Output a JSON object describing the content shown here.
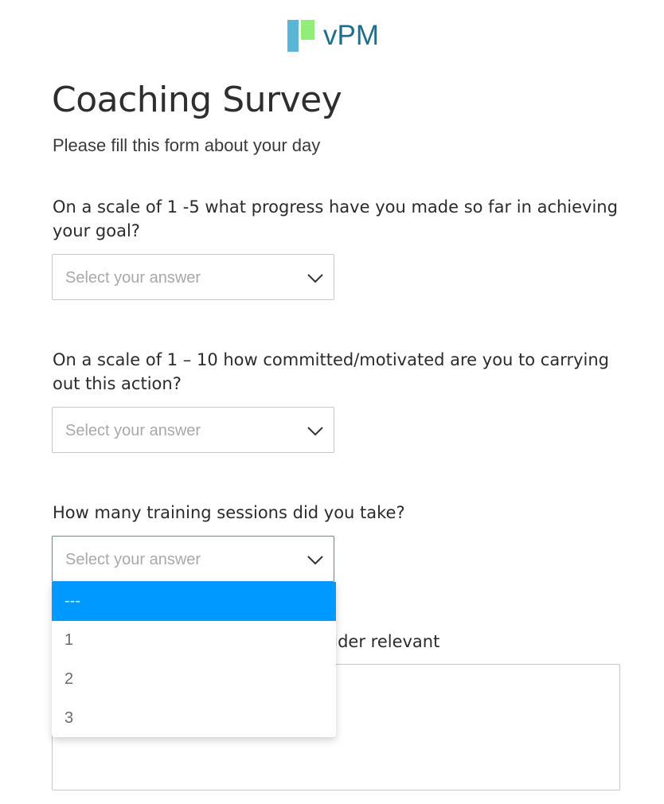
{
  "brand": {
    "logo_text": "vPM",
    "colors": {
      "logo_blue": "#5bb6d5",
      "logo_green": "#8fef7a",
      "logo_text": "#1f6f8b",
      "accent": "#0099ff"
    }
  },
  "form": {
    "title": "Coaching Survey",
    "subtitle": "Please fill this form about your day",
    "questions": [
      {
        "label": "On a scale of 1 -5 what progress have you made so far in achieving your goal?",
        "placeholder": "Select your answer",
        "state": "closed"
      },
      {
        "label": "On a scale of 1 – 10 how committed/motivated are you to carrying out this action?",
        "placeholder": "Select your answer",
        "state": "closed"
      },
      {
        "label": "How many training sessions did you take?",
        "placeholder": "Select your answer",
        "state": "open",
        "options": [
          "---",
          "1",
          "2",
          "3"
        ],
        "highlighted_option": "---"
      },
      {
        "label_visible_fragment": "nsider relevant"
      }
    ]
  },
  "icons": {
    "select_chevron": "chevron-down-icon"
  }
}
